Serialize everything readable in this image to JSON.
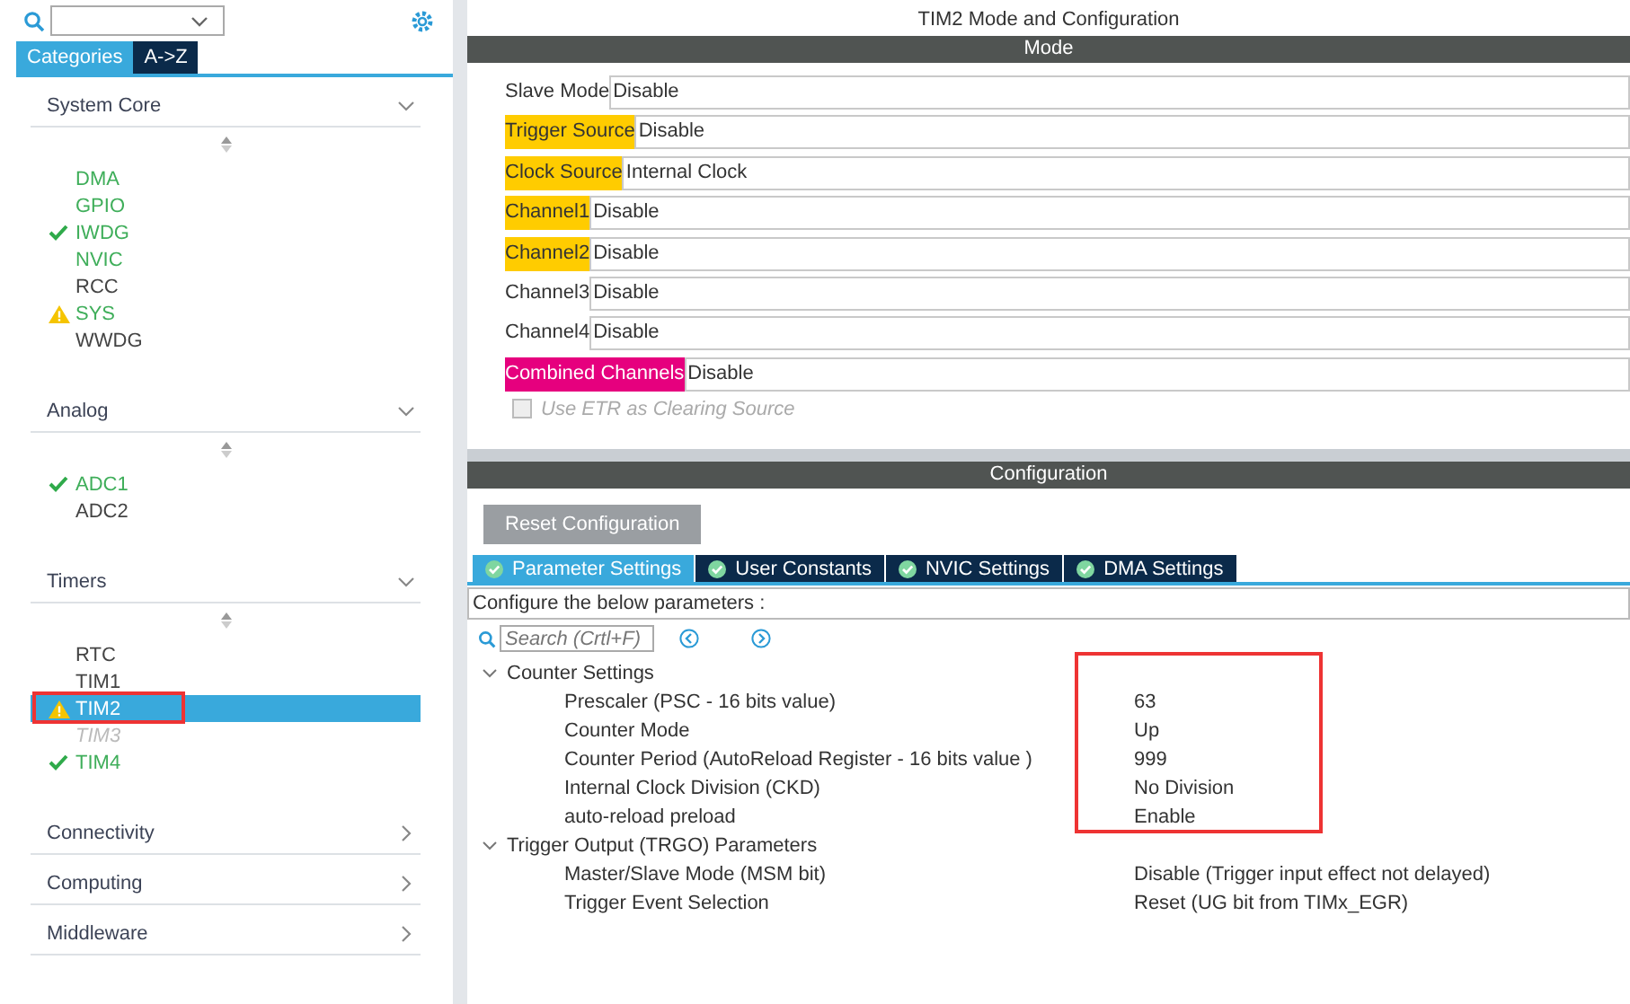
{
  "sidebar": {
    "tabs": [
      {
        "label": "Categories",
        "selected": true
      },
      {
        "label": "A->Z",
        "selected": false
      }
    ],
    "sections": [
      {
        "title": "System Core",
        "expanded": true,
        "items": [
          {
            "label": "DMA",
            "enabled": true,
            "checked": false,
            "warning": false,
            "disabled": false,
            "selected": false,
            "highlighted": false
          },
          {
            "label": "GPIO",
            "enabled": true,
            "checked": false,
            "warning": false,
            "disabled": false,
            "selected": false,
            "highlighted": false
          },
          {
            "label": "IWDG",
            "enabled": true,
            "checked": true,
            "warning": false,
            "disabled": false,
            "selected": false,
            "highlighted": false
          },
          {
            "label": "NVIC",
            "enabled": true,
            "checked": false,
            "warning": false,
            "disabled": false,
            "selected": false,
            "highlighted": false
          },
          {
            "label": "RCC",
            "enabled": false,
            "checked": false,
            "warning": false,
            "disabled": false,
            "selected": false,
            "highlighted": false
          },
          {
            "label": "SYS",
            "enabled": true,
            "checked": false,
            "warning": true,
            "disabled": false,
            "selected": false,
            "highlighted": false
          },
          {
            "label": "WWDG",
            "enabled": false,
            "checked": false,
            "warning": false,
            "disabled": false,
            "selected": false,
            "highlighted": false
          }
        ]
      },
      {
        "title": "Analog",
        "expanded": true,
        "items": [
          {
            "label": "ADC1",
            "enabled": true,
            "checked": true,
            "warning": false,
            "disabled": false,
            "selected": false,
            "highlighted": false
          },
          {
            "label": "ADC2",
            "enabled": false,
            "checked": false,
            "warning": false,
            "disabled": false,
            "selected": false,
            "highlighted": false
          }
        ]
      },
      {
        "title": "Timers",
        "expanded": true,
        "items": [
          {
            "label": "RTC",
            "enabled": false,
            "checked": false,
            "warning": false,
            "disabled": false,
            "selected": false,
            "highlighted": false
          },
          {
            "label": "TIM1",
            "enabled": false,
            "checked": false,
            "warning": false,
            "disabled": false,
            "selected": false,
            "highlighted": false
          },
          {
            "label": "TIM2",
            "enabled": true,
            "checked": false,
            "warning": true,
            "disabled": false,
            "selected": true,
            "highlighted": true
          },
          {
            "label": "TIM3",
            "enabled": false,
            "checked": false,
            "warning": false,
            "disabled": true,
            "selected": false,
            "highlighted": false
          },
          {
            "label": "TIM4",
            "enabled": true,
            "checked": true,
            "warning": false,
            "disabled": false,
            "selected": false,
            "highlighted": false
          }
        ]
      },
      {
        "title": "Connectivity",
        "expanded": false
      },
      {
        "title": "Computing",
        "expanded": false
      },
      {
        "title": "Middleware",
        "expanded": false
      }
    ]
  },
  "main": {
    "title": "TIM2 Mode and Configuration",
    "mode": {
      "heading": "Mode",
      "fields": [
        {
          "label": "Slave Mode",
          "value": "Disable"
        },
        {
          "label": "Trigger Source",
          "value": "Disable",
          "color": "#ffcc00"
        },
        {
          "label": "Clock Source",
          "value": "Internal Clock",
          "color": "#ffcc00"
        },
        {
          "label": "Channel1",
          "value": "Disable",
          "color": "#ffcc00"
        },
        {
          "label": "Channel2",
          "value": "Disable",
          "color": "#ffcc00"
        },
        {
          "label": "Channel3",
          "value": "Disable"
        },
        {
          "label": "Channel4",
          "value": "Disable"
        },
        {
          "label": "Combined Channels",
          "value": "Disable",
          "color": "#e6007e"
        }
      ],
      "options": [
        {
          "label": "Use ETR as Clearing Source",
          "checked": false,
          "disabled": true
        }
      ]
    },
    "configuration": {
      "heading": "Configuration",
      "reset_button": "Reset Configuration",
      "tabs": [
        {
          "label": "Parameter Settings",
          "selected": true
        },
        {
          "label": "User Constants",
          "selected": false
        },
        {
          "label": "NVIC Settings",
          "selected": false
        },
        {
          "label": "DMA Settings",
          "selected": false
        }
      ],
      "hint": "Configure the below parameters :",
      "search": {
        "placeholder": "Search (Crtl+F)"
      },
      "groups": [
        {
          "title": "Counter Settings",
          "expanded": true,
          "highlighted": true,
          "params": [
            {
              "name": "Prescaler (PSC - 16 bits value)",
              "value": "63"
            },
            {
              "name": "Counter Mode",
              "value": "Up"
            },
            {
              "name": "Counter Period (AutoReload Register - 16 bits value )",
              "value": "999"
            },
            {
              "name": "Internal Clock Division (CKD)",
              "value": "No Division"
            },
            {
              "name": "auto-reload preload",
              "value": "Enable"
            }
          ]
        },
        {
          "title": "Trigger Output (TRGO) Parameters",
          "expanded": true,
          "highlighted": false,
          "params": [
            {
              "name": "Master/Slave Mode (MSM bit)",
              "value": "Disable (Trigger input effect not delayed)"
            },
            {
              "name": "Trigger Event Selection",
              "value": "Reset (UG bit from TIMx_EGR)"
            }
          ]
        }
      ]
    }
  }
}
